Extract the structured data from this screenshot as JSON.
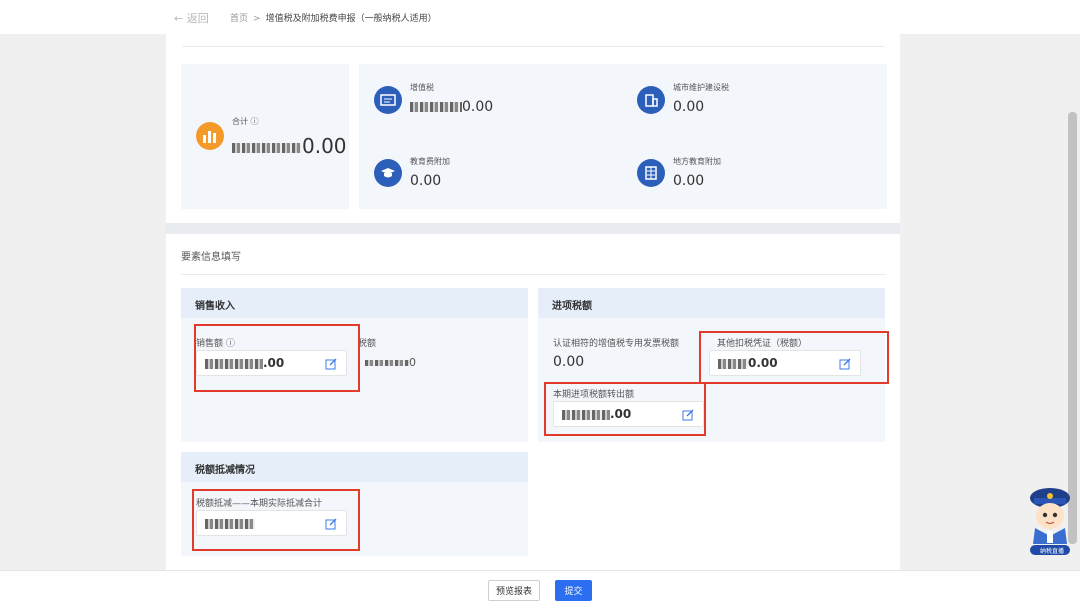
{
  "nav": {
    "back_label": "← 返回",
    "breadcrumb_home": "首页",
    "breadcrumb_sep": ">",
    "breadcrumb_current": "增值税及附加税费申报（一般纳税人适用）"
  },
  "summary": {
    "total_label": "合计 ⓘ",
    "total_value": "0.00",
    "vat_label": "增值税",
    "vat_value": "0.00",
    "urban_label": "城市维护建设税",
    "urban_value": "0.00",
    "edu_label": "教育费附加",
    "edu_value": "0.00",
    "local_edu_label": "地方教育附加",
    "local_edu_value": "0.00"
  },
  "form": {
    "section_title": "要素信息填写",
    "sales": {
      "title": "销售收入",
      "sales_amount_label": "销售额",
      "sales_amount_value": ".00",
      "tax_amount_label": "税额",
      "tax_amount_value": "0"
    },
    "input_tax": {
      "title": "进项税额",
      "certified_label": "认证相符的增值税专用发票税额",
      "certified_value": "0.00",
      "other_label": "其他扣税凭证（税额）",
      "other_value": "0.00",
      "transfer_label": "本期进项税额转出额",
      "transfer_value": ".00"
    },
    "deduction": {
      "title": "税额抵减情况",
      "label": "税额抵减——本期实际抵减合计",
      "value": ""
    }
  },
  "footer": {
    "preview_label": "预览报表",
    "submit_label": "提交"
  },
  "mascot": {
    "label": "纳税直播"
  },
  "colors": {
    "accent": "#2b6ff0",
    "highlight_box": "#e23a2b",
    "icon_orange": "#f39a2b",
    "icon_blue": "#2b5fb9"
  }
}
